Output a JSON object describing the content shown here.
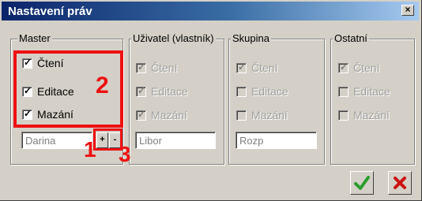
{
  "window": {
    "title": "Nastavení práv",
    "close_label": "×"
  },
  "groups": {
    "master": {
      "label": "Master",
      "checkboxes": [
        {
          "label": "Čtení",
          "checked": true
        },
        {
          "label": "Editace",
          "checked": true
        },
        {
          "label": "Mazání",
          "checked": true
        }
      ],
      "field_value": "Darina",
      "plus_label": "+",
      "minus_label": "-"
    },
    "owner": {
      "label": "Uživatel (vlastník)",
      "checkboxes": [
        {
          "label": "Čtení",
          "checked": true
        },
        {
          "label": "Editace",
          "checked": true
        },
        {
          "label": "Mazání",
          "checked": true
        }
      ],
      "field_value": "Libor"
    },
    "group": {
      "label": "Skupina",
      "checkboxes": [
        {
          "label": "Čtení",
          "checked": true
        },
        {
          "label": "Editace",
          "checked": false
        },
        {
          "label": "Mazání",
          "checked": false
        }
      ],
      "field_value": "Rozp"
    },
    "others": {
      "label": "Ostatní",
      "checkboxes": [
        {
          "label": "Čtení",
          "checked": true
        },
        {
          "label": "Editace",
          "checked": false
        },
        {
          "label": "Mazání",
          "checked": false
        }
      ]
    }
  },
  "annotations": {
    "one": "1",
    "two": "2",
    "three": "3"
  },
  "check_mark": "✓",
  "actions": {
    "ok_icon": "green-check-icon",
    "cancel_icon": "red-cross-icon"
  },
  "colors": {
    "annotation": "#ee1111",
    "ok": "#2a9d2a",
    "cancel": "#cc1111",
    "title_start": "#0a246a"
  }
}
